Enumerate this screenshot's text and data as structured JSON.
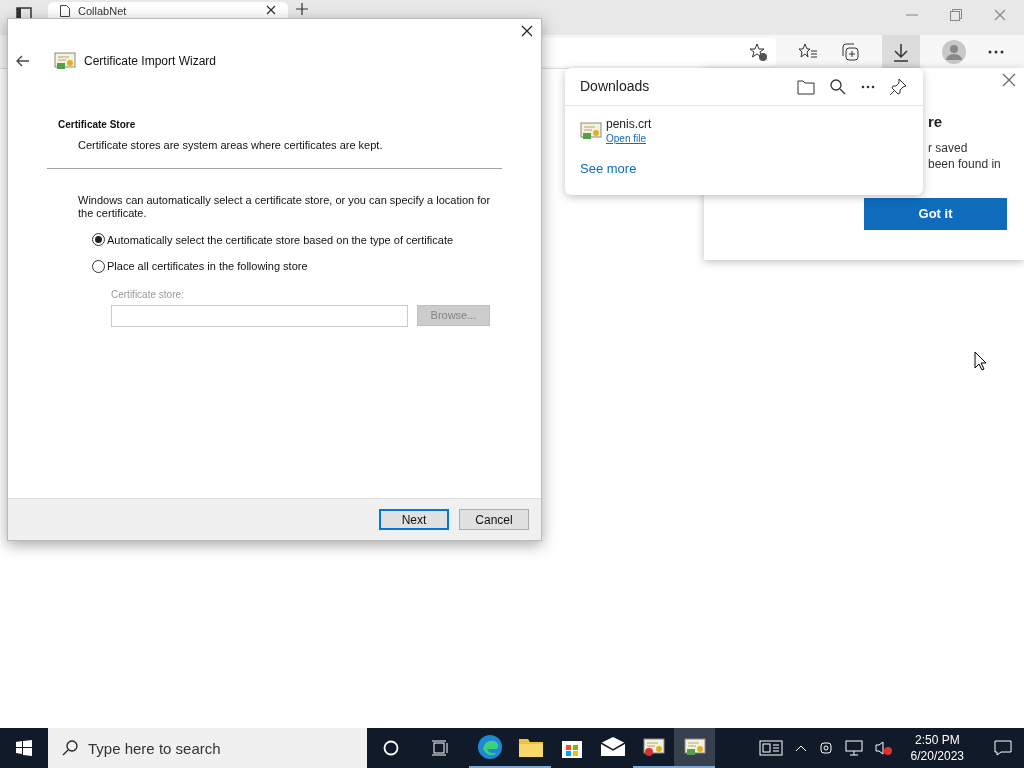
{
  "browser": {
    "tab": {
      "title": "CollabNet"
    },
    "downloads_panel": {
      "title": "Downloads",
      "items": [
        {
          "name": "penis.crt",
          "action": "Open file"
        }
      ],
      "see_more": "See more"
    },
    "tip_popup": {
      "heading": "re",
      "lines": [
        "r saved",
        "been found in"
      ],
      "button": "Got it"
    }
  },
  "dialog": {
    "title": "Certificate Import Wizard",
    "section_title": "Certificate Store",
    "section_subtitle": "Certificate stores are system areas where certificates are kept.",
    "description": "Windows can automatically select a certificate store, or you can specify a location for the certificate.",
    "options": [
      {
        "label": "Automatically select the certificate store based on the type of certificate",
        "selected": true
      },
      {
        "label": "Place all certificates in the following store",
        "selected": false
      }
    ],
    "store_field": {
      "label": "Certificate store:",
      "disabled": true
    },
    "browse_button": {
      "label": "Browse...",
      "disabled": true
    },
    "buttons": [
      {
        "label": "Next",
        "kind": "primary"
      },
      {
        "label": "Cancel",
        "kind": "default"
      }
    ]
  },
  "taskbar": {
    "search_placeholder": "Type here to search",
    "apps": [
      {
        "kind": "edge",
        "running": true,
        "selected": false
      },
      {
        "kind": "explorer",
        "running": true,
        "selected": false
      },
      {
        "kind": "store",
        "running": false,
        "selected": false
      },
      {
        "kind": "mail",
        "running": false,
        "selected": false
      },
      {
        "kind": "cert-error",
        "running": true,
        "selected": false
      },
      {
        "kind": "cert-wizard",
        "running": true,
        "selected": true
      }
    ],
    "time": "2:50 PM",
    "date": "6/20/2023"
  }
}
